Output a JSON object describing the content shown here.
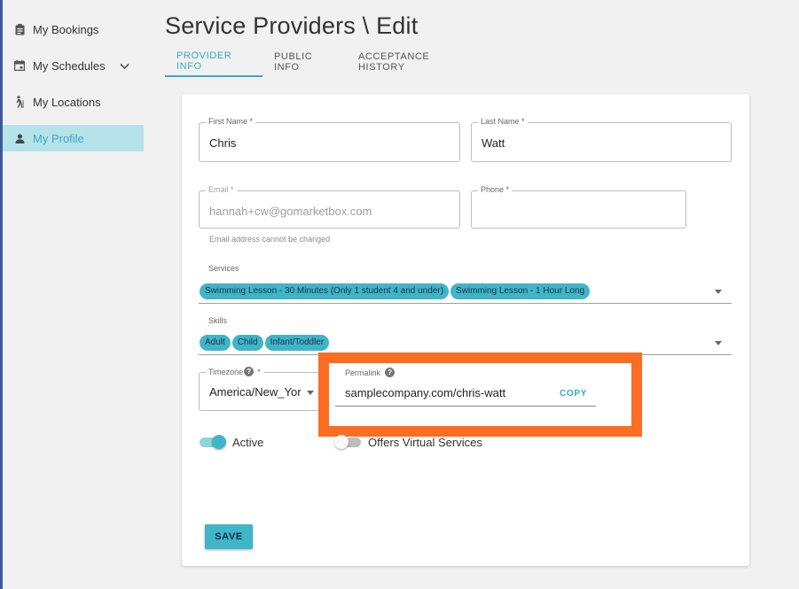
{
  "sidebar": {
    "items": [
      {
        "label": "My Bookings",
        "icon": "clipboard-icon"
      },
      {
        "label": "My Schedules",
        "icon": "calendar-icon"
      },
      {
        "label": "My Locations",
        "icon": "walking-person-icon"
      },
      {
        "label": "My Profile",
        "icon": "person-icon"
      }
    ]
  },
  "page": {
    "title": "Service Providers \\ Edit"
  },
  "tabs": [
    {
      "label": "PROVIDER INFO",
      "active": true
    },
    {
      "label": "PUBLIC INFO"
    },
    {
      "label": "ACCEPTANCE HISTORY"
    }
  ],
  "form": {
    "first_name": {
      "label": "First Name *",
      "value": "Chris"
    },
    "last_name": {
      "label": "Last Name *",
      "value": "Watt"
    },
    "email": {
      "label": "Email *",
      "value": "hannah+cw@gomarketbox.com",
      "helper": "Email address cannot be changed"
    },
    "phone": {
      "label": "Phone *",
      "value": ""
    },
    "services": {
      "label": "Services",
      "chips": [
        "Swimming Lesson - 30 Minutes (Only 1 student 4 and under)",
        "Swimming Lesson - 1 Hour Long"
      ]
    },
    "skills": {
      "label": "Skills",
      "chips": [
        "Adult",
        "Child",
        "Infant/Toddler"
      ]
    },
    "timezone": {
      "label": "Timezone",
      "required_mark": "*",
      "value": "America/New_Yor"
    },
    "permalink": {
      "label": "Permalink",
      "value": "samplecompany.com/chris-watt",
      "copy_label": "COPY"
    },
    "active_toggle": {
      "label": "Active",
      "on": true
    },
    "virtual_toggle": {
      "label": "Offers Virtual Services",
      "on": false
    },
    "save_label": "SAVE"
  },
  "colors": {
    "accent": "#40b4c9",
    "highlight": "#fb6d22",
    "active_sidebar_bg": "#b6e3ea"
  }
}
